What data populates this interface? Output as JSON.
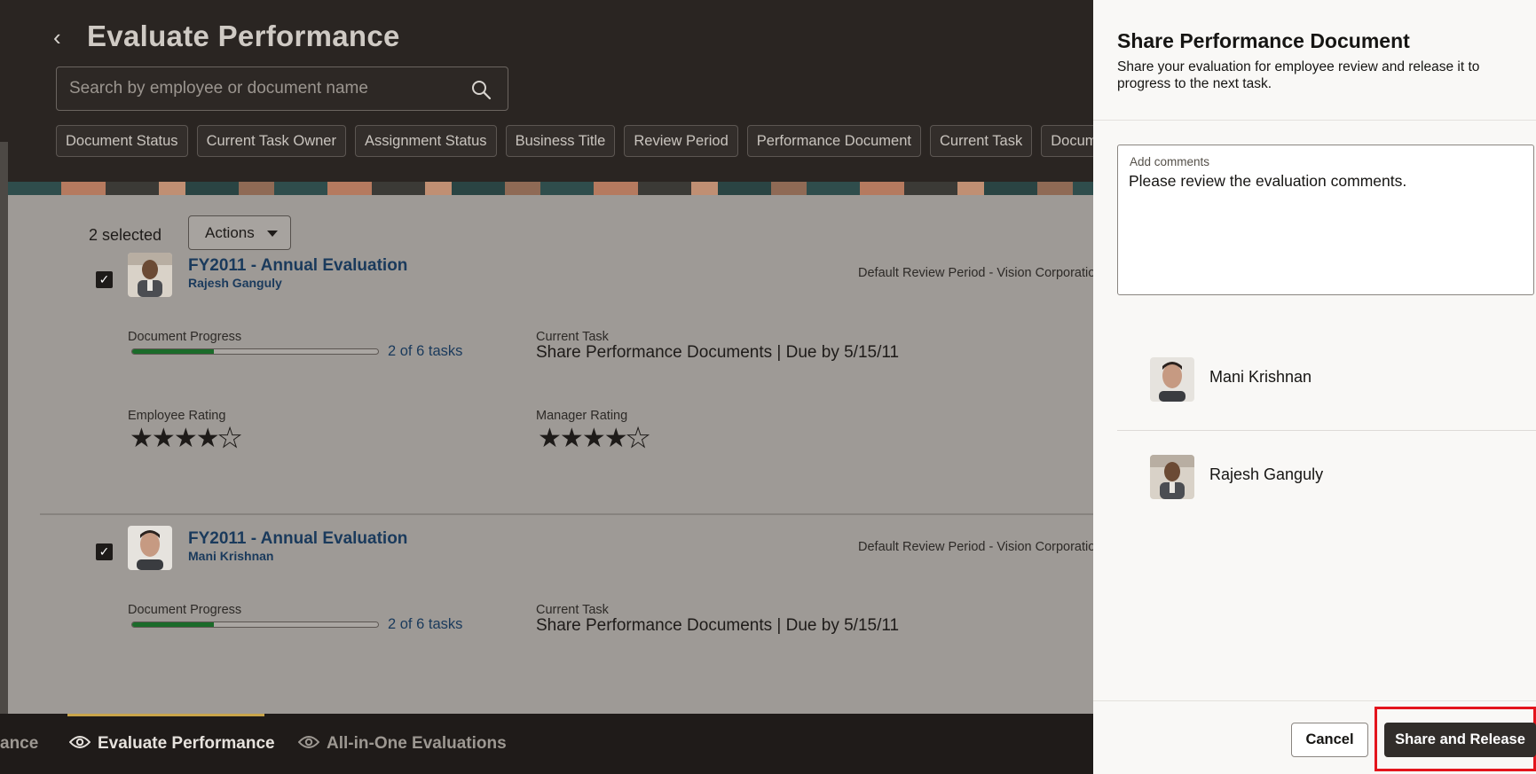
{
  "page": {
    "title": "Evaluate Performance",
    "search_placeholder": "Search by employee or document name"
  },
  "filters": [
    "Document Status",
    "Current Task Owner",
    "Assignment Status",
    "Business Title",
    "Review Period",
    "Performance Document",
    "Current Task",
    "Document Ty"
  ],
  "selection": {
    "count_label": "2 selected",
    "actions_label": "Actions"
  },
  "documents": [
    {
      "title": "FY2011 - Annual Evaluation",
      "employee": "Rajesh Ganguly",
      "review_period": "Default Review Period - Vision Corporation",
      "progress_label": "Document Progress",
      "progress_text": "2 of 6 tasks",
      "progress_fraction": 0.333,
      "task_label": "Current Task",
      "task_text": "Share Performance Documents | Due by 5/15/11",
      "employee_rating_label": "Employee Rating",
      "employee_rating": 4,
      "manager_rating_label": "Manager Rating",
      "manager_rating": 4,
      "max_rating": 5
    },
    {
      "title": "FY2011 - Annual Evaluation",
      "employee": "Mani Krishnan",
      "review_period": "Default Review Period - Vision Corporation",
      "progress_label": "Document Progress",
      "progress_text": "2 of 6 tasks",
      "progress_fraction": 0.333,
      "task_label": "Current Task",
      "task_text": "Share Performance Documents | Due by 5/15/11"
    }
  ],
  "bottom_nav": {
    "items": [
      {
        "label": "ance",
        "icon": "",
        "active": false
      },
      {
        "label": "Evaluate Performance",
        "icon": "eye-icon",
        "active": true
      },
      {
        "label": "All-in-One Evaluations",
        "icon": "eye-icon",
        "active": false
      }
    ]
  },
  "drawer": {
    "title": "Share Performance Document",
    "subtitle": "Share your evaluation for employee review and release it to progress to the next task.",
    "comments_label": "Add comments",
    "comments_value": "Please review the evaluation comments.",
    "recipients": [
      "Mani Krishnan",
      "Rajesh Ganguly"
    ],
    "cancel_label": "Cancel",
    "share_label": "Share and Release"
  },
  "colors": {
    "accent_dark": "#312d2a",
    "link": "#1a3a5c",
    "progress": "#1b6b2a",
    "highlight": "#e3141c",
    "nav_active": "#c8a44a"
  }
}
